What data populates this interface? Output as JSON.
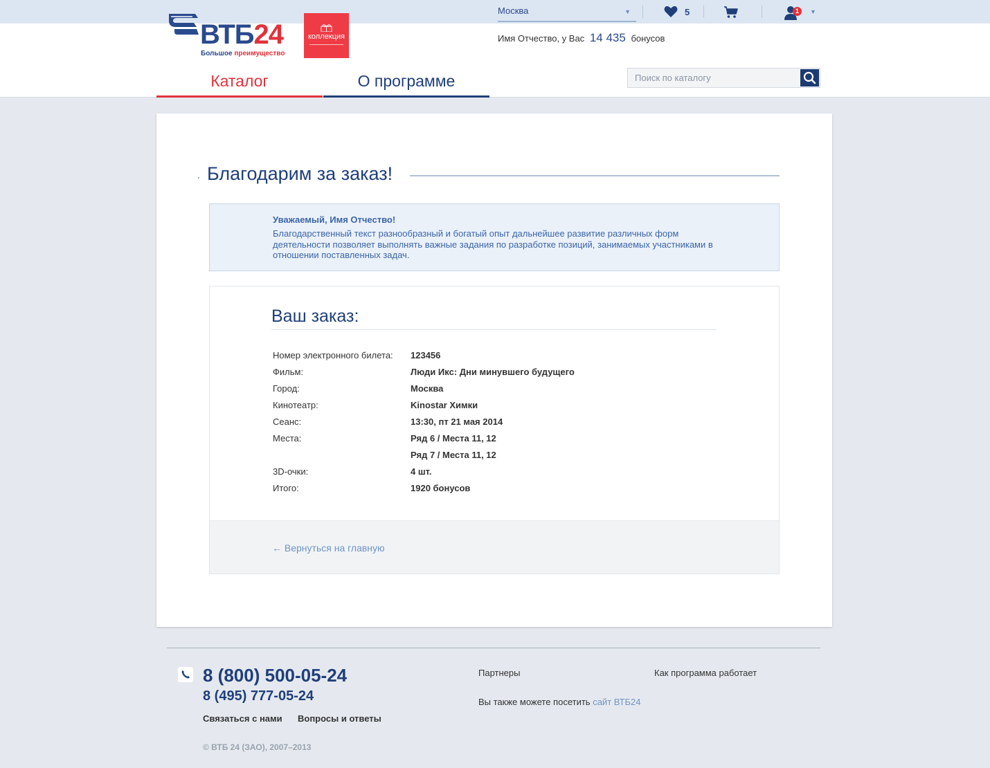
{
  "header": {
    "logo_text_main": "ВТБ",
    "logo_text_num": "24",
    "logo_slogan_a": "Большое ",
    "logo_slogan_b": "преимущество",
    "collection_label": "коллекция",
    "city": "Москва",
    "favorites_count": "5",
    "user_badge": "1",
    "bonus_prefix": "Имя Отчество, у Вас",
    "bonus_amount": "14 435",
    "bonus_suffix": "бонусов"
  },
  "nav": {
    "catalog": "Каталог",
    "program": "О программе"
  },
  "search": {
    "placeholder": "Поиск по каталогу"
  },
  "main": {
    "title": "Благодарим за заказ!",
    "greeting_title": "Уважаемый, Имя Отчество!",
    "greeting_text": "Благодарственный текст разнообразный и богатый опыт дальнейшее развитие различных форм деятельности позволяет выполнять важные задания по разработке позиций, занимаемых участниками в отношении поставленных задач.",
    "order_title": "Ваш заказ:",
    "order_rows": [
      {
        "label": "Номер электронного билета:",
        "value": "123456"
      },
      {
        "label": "Фильм:",
        "value": "Люди Икс: Дни минувшего будущего"
      },
      {
        "label": "Город:",
        "value": "Москва"
      },
      {
        "label": "Кинотеатр:",
        "value": "Kinostar Химки"
      },
      {
        "label": "Сеанс:",
        "value": "13:30, пт 21 мая 2014"
      },
      {
        "label": "Места:",
        "value": "Ряд 6 / Места 11, 12"
      },
      {
        "label": "",
        "value": "Ряд 7 / Места 11, 12"
      },
      {
        "label": "3D-очки:",
        "value": "4 шт."
      },
      {
        "label": "Итого:",
        "value": "1920 бонусов"
      }
    ],
    "back_link": "← Вернуться на главную"
  },
  "footer": {
    "phone_main": "8 (800) 500-05-24",
    "phone_alt": "8 (495) 777-05-24",
    "contact": "Связаться с нами",
    "faq": "Вопросы и ответы",
    "copyright": "© ВТБ 24 (ЗАО), 2007–2013",
    "partners": "Партнеры",
    "how_it_works": "Как программа работает",
    "visit_prefix": "Вы также можете посетить",
    "visit_link": "сайт ВТБ24"
  },
  "colors": {
    "brand_blue": "#1f3f7a",
    "brand_red": "#e1323c",
    "link_blue": "#6e94c3"
  }
}
